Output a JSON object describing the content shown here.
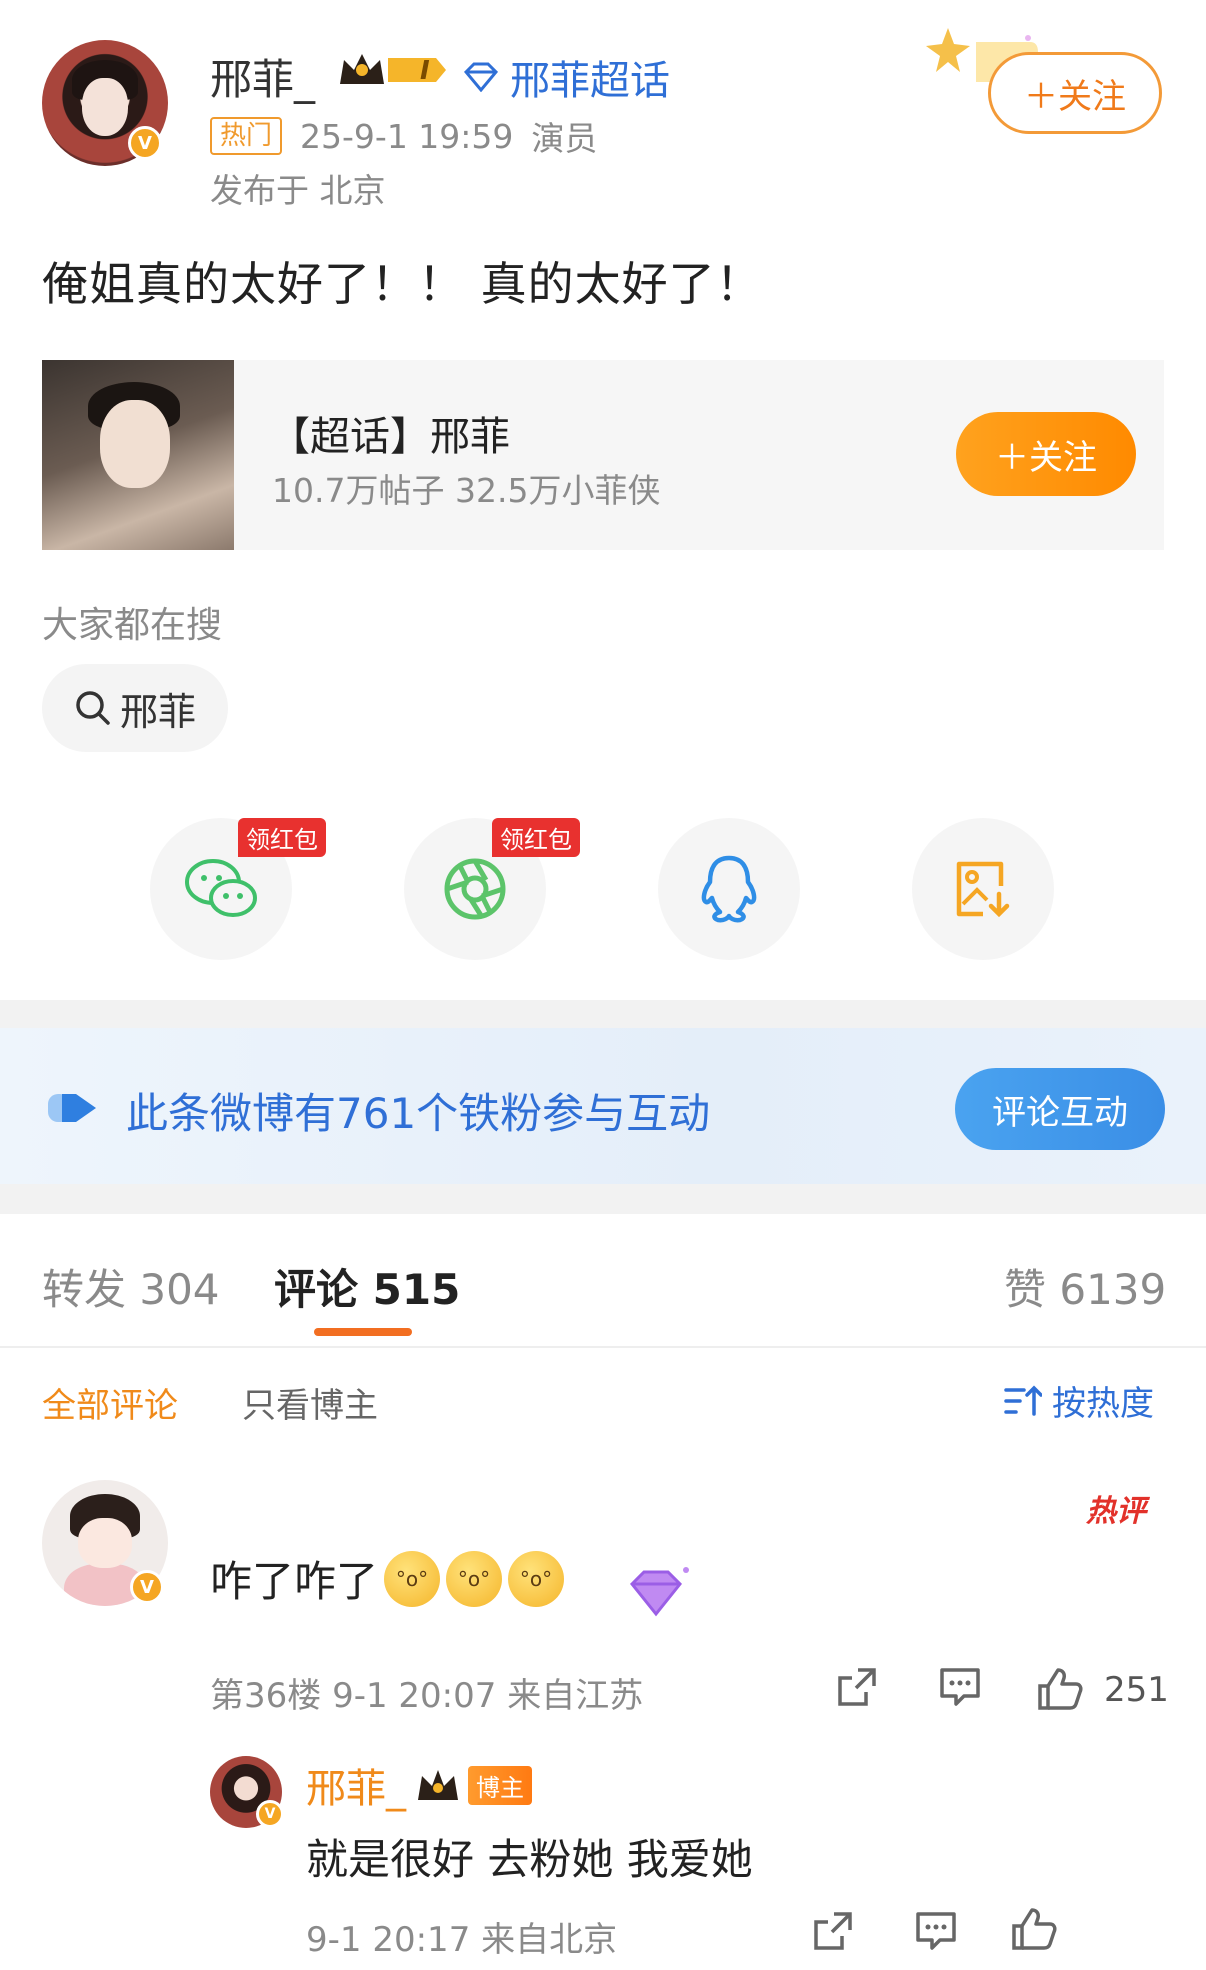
{
  "post": {
    "author": "邢菲_",
    "level": "I",
    "chaohua_link": "邢菲超话",
    "hot_tag": "热门",
    "time": "25-9-1 19:59",
    "role": "演员",
    "location": "发布于 北京",
    "follow_label": "＋关注",
    "text": "俺姐真的太好了！！ 真的太好了！"
  },
  "supertopic": {
    "title": "【超话】邢菲",
    "stats": "10.7万帖子 32.5万小菲侠",
    "follow_label": "＋关注"
  },
  "search": {
    "label": "大家都在搜",
    "chip": "邢菲"
  },
  "share": {
    "items": [
      {
        "icon": "wechat-icon",
        "badge": "领红包"
      },
      {
        "icon": "moments-icon",
        "badge": "领红包"
      },
      {
        "icon": "qq-icon",
        "badge": ""
      },
      {
        "icon": "save-image-icon",
        "badge": ""
      }
    ]
  },
  "fans_banner": {
    "text": "此条微博有761个铁粉参与互动",
    "button": "评论互动"
  },
  "tabs": {
    "repost": "转发 304",
    "comment": "评论 515",
    "like": "赞 6139"
  },
  "filters": {
    "all": "全部评论",
    "author_only": "只看博主",
    "sort": "按热度"
  },
  "comment": {
    "text": "咋了咋了",
    "hot_label": "热评",
    "meta": "第36楼 9-1 20:07 来自江苏",
    "likes": "251"
  },
  "reply": {
    "author": "邢菲_",
    "tag": "博主",
    "text": "就是很好 去粉她 我爱她",
    "meta": "9-1 20:17 来自北京"
  },
  "colors": {
    "accent_orange": "#f08a1a",
    "link_blue": "#2f6fd6",
    "hot_red": "#e2312a"
  }
}
